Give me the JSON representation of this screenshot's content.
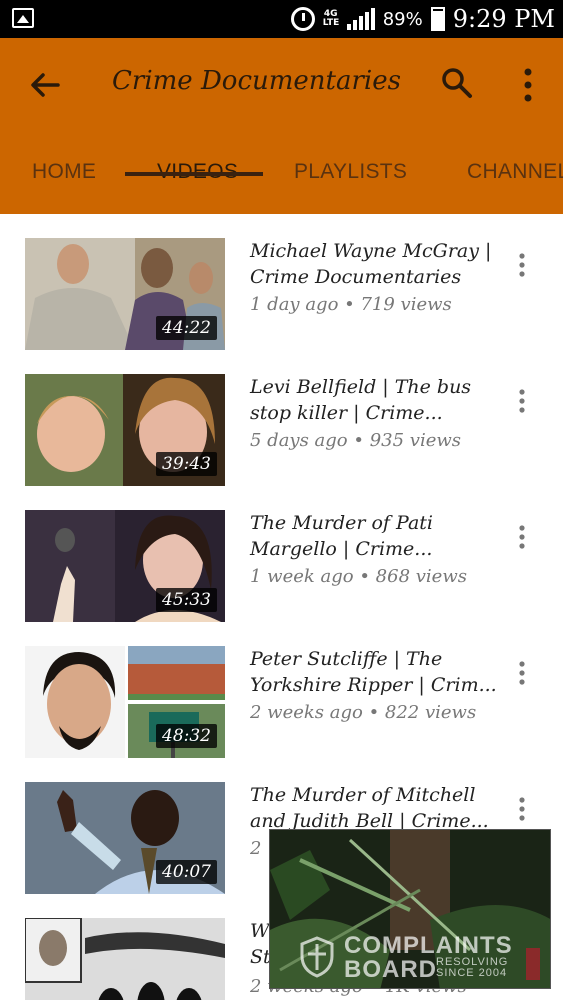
{
  "status_bar": {
    "network": "4G LTE",
    "battery_pct": "89%",
    "time": "9:29 PM",
    "icons": [
      "image-icon",
      "alarm-icon",
      "signal-icon",
      "battery-charging-icon"
    ]
  },
  "app_bar": {
    "title": "Crime Documentaries",
    "color": "#cc6600",
    "icons": [
      "back-arrow-icon",
      "search-icon",
      "more-vert-icon"
    ]
  },
  "tabs": [
    {
      "label": "HOME",
      "active": false
    },
    {
      "label": "VIDEOS",
      "active": true
    },
    {
      "label": "PLAYLISTS",
      "active": false
    },
    {
      "label": "CHANNEL",
      "active": false
    }
  ],
  "videos": [
    {
      "title_line1": "Michael Wayne McGray |",
      "title_line2": "Crime Documentaries",
      "meta": "1 day ago • 719 views",
      "duration": "44:22"
    },
    {
      "title_line1": "Levi Bellfield | The bus",
      "title_line2": "stop killer | Crime...",
      "meta": "5 days ago • 935 views",
      "duration": "39:43"
    },
    {
      "title_line1": "The Murder of Pati",
      "title_line2": "Margello | Crime...",
      "meta": "1 week ago • 868 views",
      "duration": "45:33"
    },
    {
      "title_line1": "Peter Sutcliffe | The",
      "title_line2": "Yorkshire Ripper | Crim...",
      "meta": "2 weeks ago • 822 views",
      "duration": "48:32"
    },
    {
      "title_line1": "The Murder of Mitchell",
      "title_line2": "and Judith Bell | Crime...",
      "meta": "2",
      "duration": "40:07"
    },
    {
      "title_line1": "W",
      "title_line2": "St",
      "meta": "2 weeks ago • 1K views",
      "duration": ""
    }
  ],
  "watermark": {
    "line1": "COMPLAINTS",
    "line2": "BOARD",
    "line3a": "RESOLVING",
    "line3b": "SINCE 2004"
  }
}
